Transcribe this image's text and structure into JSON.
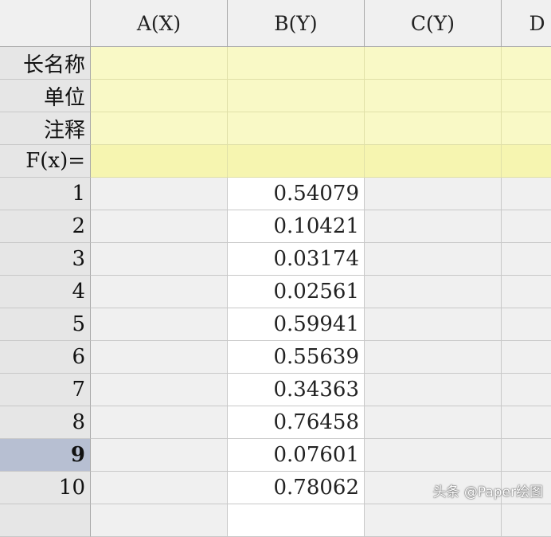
{
  "columns": [
    "A(X)",
    "B(Y)",
    "C(Y)",
    "D"
  ],
  "label_rows": [
    "长名称",
    "单位",
    "注释",
    "F(x)="
  ],
  "rows": [
    {
      "num": "1",
      "b": "0.54079"
    },
    {
      "num": "2",
      "b": "0.10421"
    },
    {
      "num": "3",
      "b": "0.03174"
    },
    {
      "num": "4",
      "b": "0.02561"
    },
    {
      "num": "5",
      "b": "0.59941"
    },
    {
      "num": "6",
      "b": "0.55639"
    },
    {
      "num": "7",
      "b": "0.34363"
    },
    {
      "num": "8",
      "b": "0.76458"
    },
    {
      "num": "9",
      "b": "0.07601"
    },
    {
      "num": "10",
      "b": "0.78062"
    }
  ],
  "selected_row": "9",
  "watermark": "头条 @Paper绘图"
}
